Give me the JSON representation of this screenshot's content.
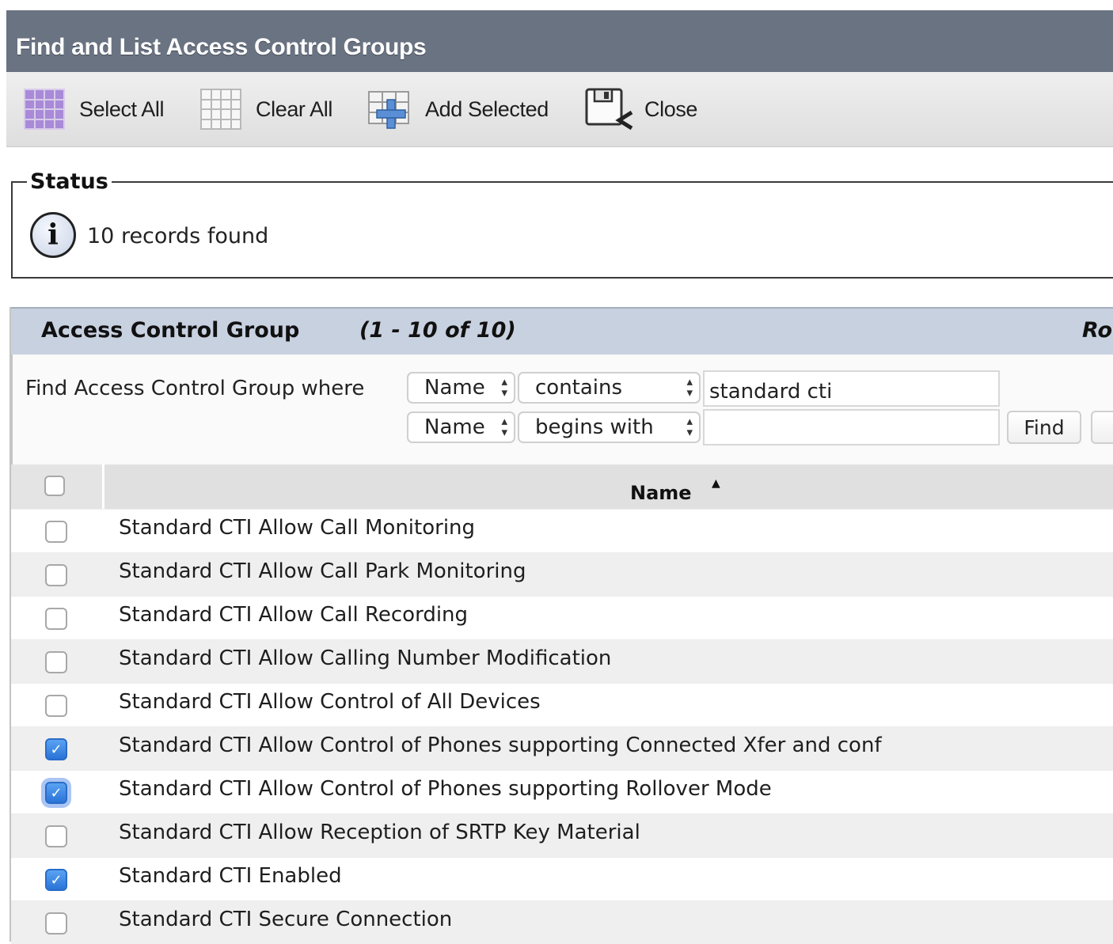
{
  "window": {
    "title": "Find and List Access Control Groups"
  },
  "toolbar": {
    "select_all": "Select All",
    "clear_all": "Clear All",
    "add_selected": "Add Selected",
    "close": "Close"
  },
  "status": {
    "legend": "Status",
    "message": "10 records found",
    "icon": "info-icon"
  },
  "panel": {
    "title": "Access Control Group",
    "range": "(1 - 10 of 10)",
    "right_label": "Ro"
  },
  "search": {
    "label": "Find Access Control Group where",
    "row1": {
      "field": "Name",
      "operator": "contains",
      "value": "standard cti"
    },
    "row2": {
      "field": "Name",
      "operator": "begins with",
      "value": ""
    },
    "find_button": "Find"
  },
  "table": {
    "header": {
      "name": "Name",
      "sort": "ascending"
    },
    "rows": [
      {
        "name": "Standard CTI Allow Call Monitoring",
        "checked": false
      },
      {
        "name": "Standard CTI Allow Call Park Monitoring",
        "checked": false
      },
      {
        "name": "Standard CTI Allow Call Recording",
        "checked": false
      },
      {
        "name": "Standard CTI Allow Calling Number Modification",
        "checked": false
      },
      {
        "name": "Standard CTI Allow Control of All Devices",
        "checked": false
      },
      {
        "name": "Standard CTI Allow Control of Phones supporting Connected Xfer and conf",
        "checked": true
      },
      {
        "name": "Standard CTI Allow Control of Phones supporting Rollover Mode",
        "checked": true
      },
      {
        "name": "Standard CTI Allow Reception of SRTP Key Material",
        "checked": false
      },
      {
        "name": "Standard CTI Enabled",
        "checked": true
      },
      {
        "name": "Standard CTI Secure Connection",
        "checked": false
      }
    ]
  },
  "colors": {
    "title_bar": "#6a7382",
    "panel_header": "#c8d1e0",
    "checkbox_checked": "#2a74d8"
  }
}
